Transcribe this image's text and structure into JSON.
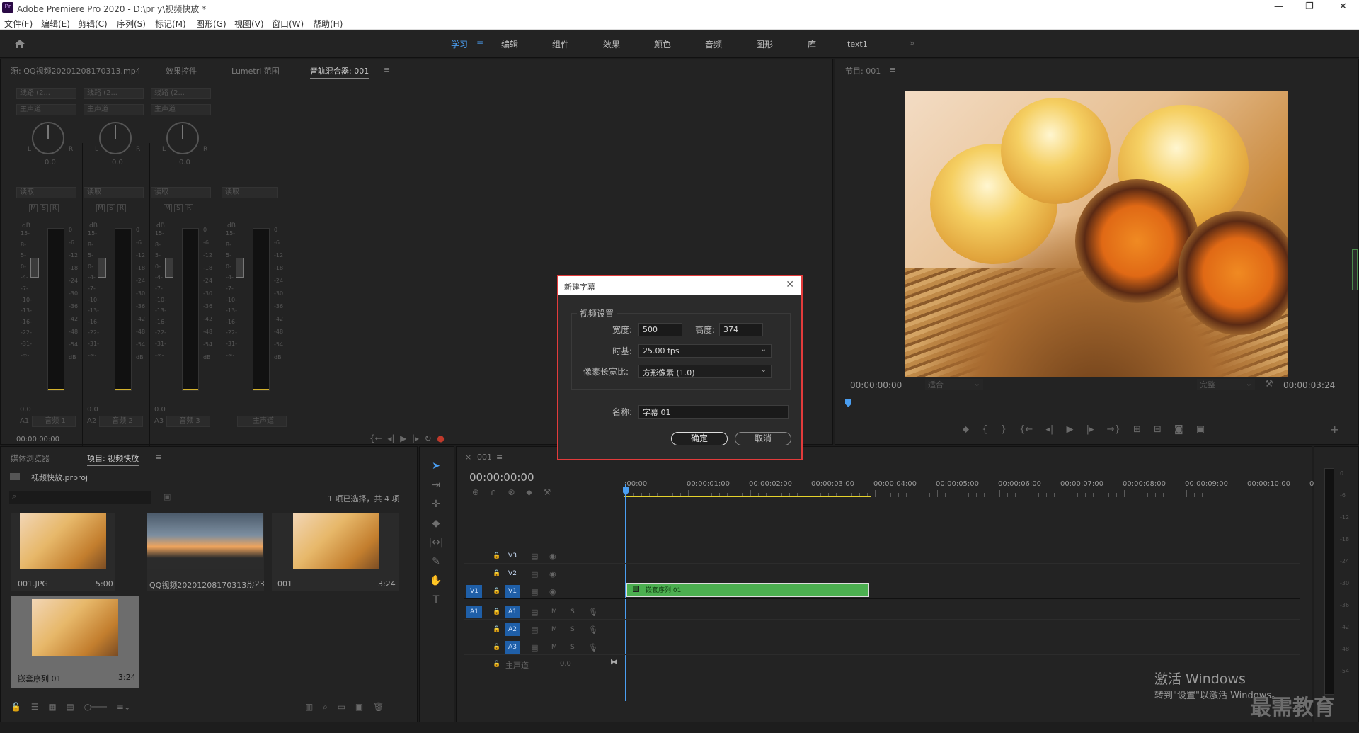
{
  "window": {
    "logo": "Pr",
    "title": "Adobe Premiere Pro 2020 - D:\\pr y\\视频快放 *",
    "minimize": "—",
    "restore": "❐",
    "close": "✕"
  },
  "menu": [
    "文件(F)",
    "编辑(E)",
    "剪辑(C)",
    "序列(S)",
    "标记(M)",
    "图形(G)",
    "视图(V)",
    "窗口(W)",
    "帮助(H)"
  ],
  "workspaces": {
    "tabs": [
      "学习",
      "编辑",
      "组件",
      "效果",
      "颜色",
      "音频",
      "图形",
      "库",
      "text1"
    ],
    "active": "学习",
    "more": "»"
  },
  "source_panel": {
    "tabs": [
      "源: QQ视频20201208170313.mp4",
      "效果控件",
      "Lumetri 范围",
      "音轨混合器: 001"
    ],
    "active": "音轨混合器: 001",
    "timecode": "00:00:00:00"
  },
  "mixer": {
    "strips": [
      {
        "mode": "线路 (2...",
        "bus": "主声道",
        "pan": "0.0",
        "auto": "读取",
        "track": "A1",
        "name": "音频 1"
      },
      {
        "mode": "线路 (2...",
        "bus": "主声道",
        "pan": "0.0",
        "auto": "读取",
        "track": "A2",
        "name": "音频 2"
      },
      {
        "mode": "线路 (2...",
        "bus": "主声道",
        "pan": "0.0",
        "auto": "读取",
        "track": "A3",
        "name": "音频 3"
      },
      {
        "mode": "",
        "bus": "",
        "pan": "",
        "auto": "读取",
        "track": "",
        "name": "主声道"
      }
    ],
    "msr": [
      "M",
      "S",
      "R"
    ],
    "db_label": "dB",
    "fader_scale": [
      "15-",
      "8-",
      "5-",
      "0-",
      "-4-",
      "-7-",
      "-10-",
      "-13-",
      "-16-",
      "-22-",
      "-31-",
      "-∞-"
    ],
    "meter_scale": [
      "0",
      "-6",
      "-12",
      "-18",
      "-24",
      "-30",
      "-36",
      "-42",
      "-48",
      "-54",
      "dB"
    ]
  },
  "program_panel": {
    "tab": "节目: 001",
    "tc_left": "00:00:00:00",
    "fit": "适合",
    "quality": "完整",
    "tc_right": "00:00:03:24"
  },
  "project_panel": {
    "tabs": [
      "媒体浏览器",
      "项目: 视频快放"
    ],
    "active": "项目: 视频快放",
    "file": "视频快放.prproj",
    "selection": "1 项已选择，共 4 项",
    "items": [
      {
        "name": "001.JPG",
        "duration": "5:00"
      },
      {
        "name": "QQ视频20201208170313...",
        "duration": "8;23"
      },
      {
        "name": "001",
        "duration": "3:24"
      },
      {
        "name": "嵌套序列 01",
        "duration": "3:24"
      }
    ]
  },
  "timeline": {
    "tab": "001",
    "timecode": "00:00:00:00",
    "ruler": [
      ":00:00",
      "00:00:01:00",
      "00:00:02:00",
      "00:00:03:00",
      "00:00:04:00",
      "00:00:05:00",
      "00:00:06:00",
      "00:00:07:00",
      "00:00:08:00",
      "00:00:09:00",
      "00:00:10:00",
      "00"
    ],
    "video_tracks": [
      "V3",
      "V2",
      "V1"
    ],
    "audio_tracks": [
      "A1",
      "A2",
      "A3"
    ],
    "source_patch_v": "V1",
    "source_patch_a": "A1",
    "audio_ms": [
      "M",
      "S"
    ],
    "master": {
      "name": "主声道",
      "value": "0.0"
    },
    "clip": {
      "name": "嵌套序列 01",
      "color": "#4caf50"
    }
  },
  "right_meter": {
    "scale": [
      "0",
      "-6",
      "-12",
      "-18",
      "-24",
      "-30",
      "-36",
      "-42",
      "-48",
      "-54"
    ]
  },
  "dialog": {
    "title": "新建字幕",
    "group": "视频设置",
    "width_label": "宽度:",
    "width": "500",
    "height_label": "高度:",
    "height": "374",
    "timebase_label": "时基:",
    "timebase": "25.00 fps",
    "par_label": "像素长宽比:",
    "par": "方形像素 (1.0)",
    "name_label": "名称:",
    "name": "字幕 01",
    "ok": "确定",
    "cancel": "取消"
  },
  "watermark": {
    "line1": "激活 Windows",
    "line2": "转到\"设置\"以激活 Windows。",
    "brand": "最需教育"
  }
}
